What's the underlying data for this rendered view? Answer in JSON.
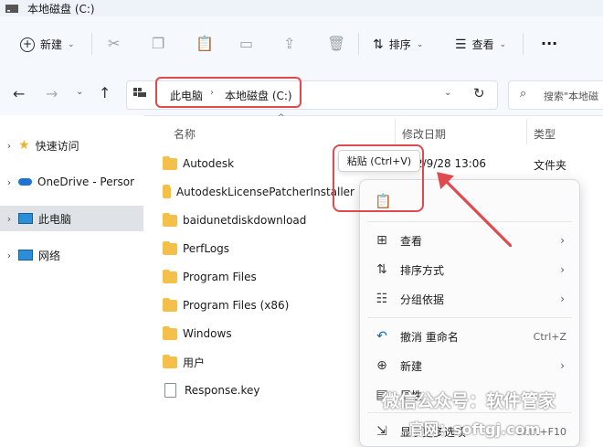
{
  "window": {
    "title": "本地磁盘 (C:)"
  },
  "toolbar": {
    "new_label": "新建",
    "sort_label": "排序",
    "view_label": "查看",
    "more_label": "···"
  },
  "address": {
    "crumbs": [
      "此电脑",
      "本地磁盘 (C:)"
    ],
    "search_placeholder": "搜索\"本地磁"
  },
  "nav": {
    "items": [
      {
        "label": "快速访问"
      },
      {
        "label": "OneDrive - Persor"
      },
      {
        "label": "此电脑"
      },
      {
        "label": "网络"
      }
    ]
  },
  "columns": {
    "name": "名称",
    "modified": "修改日期",
    "type": "类型"
  },
  "files": [
    {
      "name": "Autodesk",
      "date": "2/9/28 13:06",
      "type": "文件夹"
    },
    {
      "name": "AutodeskLicensePatcherInstaller"
    },
    {
      "name": "baidunetdiskdownload"
    },
    {
      "name": "PerfLogs"
    },
    {
      "name": "Program Files"
    },
    {
      "name": "Program Files (x86)"
    },
    {
      "name": "Windows"
    },
    {
      "name": "用户"
    },
    {
      "name": "Response.key"
    }
  ],
  "tooltip": {
    "text": "粘贴 (Ctrl+V)"
  },
  "menu": {
    "items": [
      {
        "label": "查看"
      },
      {
        "label": "排序方式"
      },
      {
        "label": "分组依据"
      },
      {
        "label": "撤消 重命名",
        "shortcut": "Ctrl+Z"
      },
      {
        "label": "新建"
      },
      {
        "label": "属性"
      },
      {
        "label": "显示更多选项",
        "shortcut": "Shift+F10"
      }
    ]
  },
  "watermark": {
    "line1": "微信公众号：软件管家",
    "line2": "官网：softgj.com"
  },
  "colors": {
    "accent": "#0067c0",
    "highlight": "#e04a4e",
    "folder": "#f5c04a"
  }
}
